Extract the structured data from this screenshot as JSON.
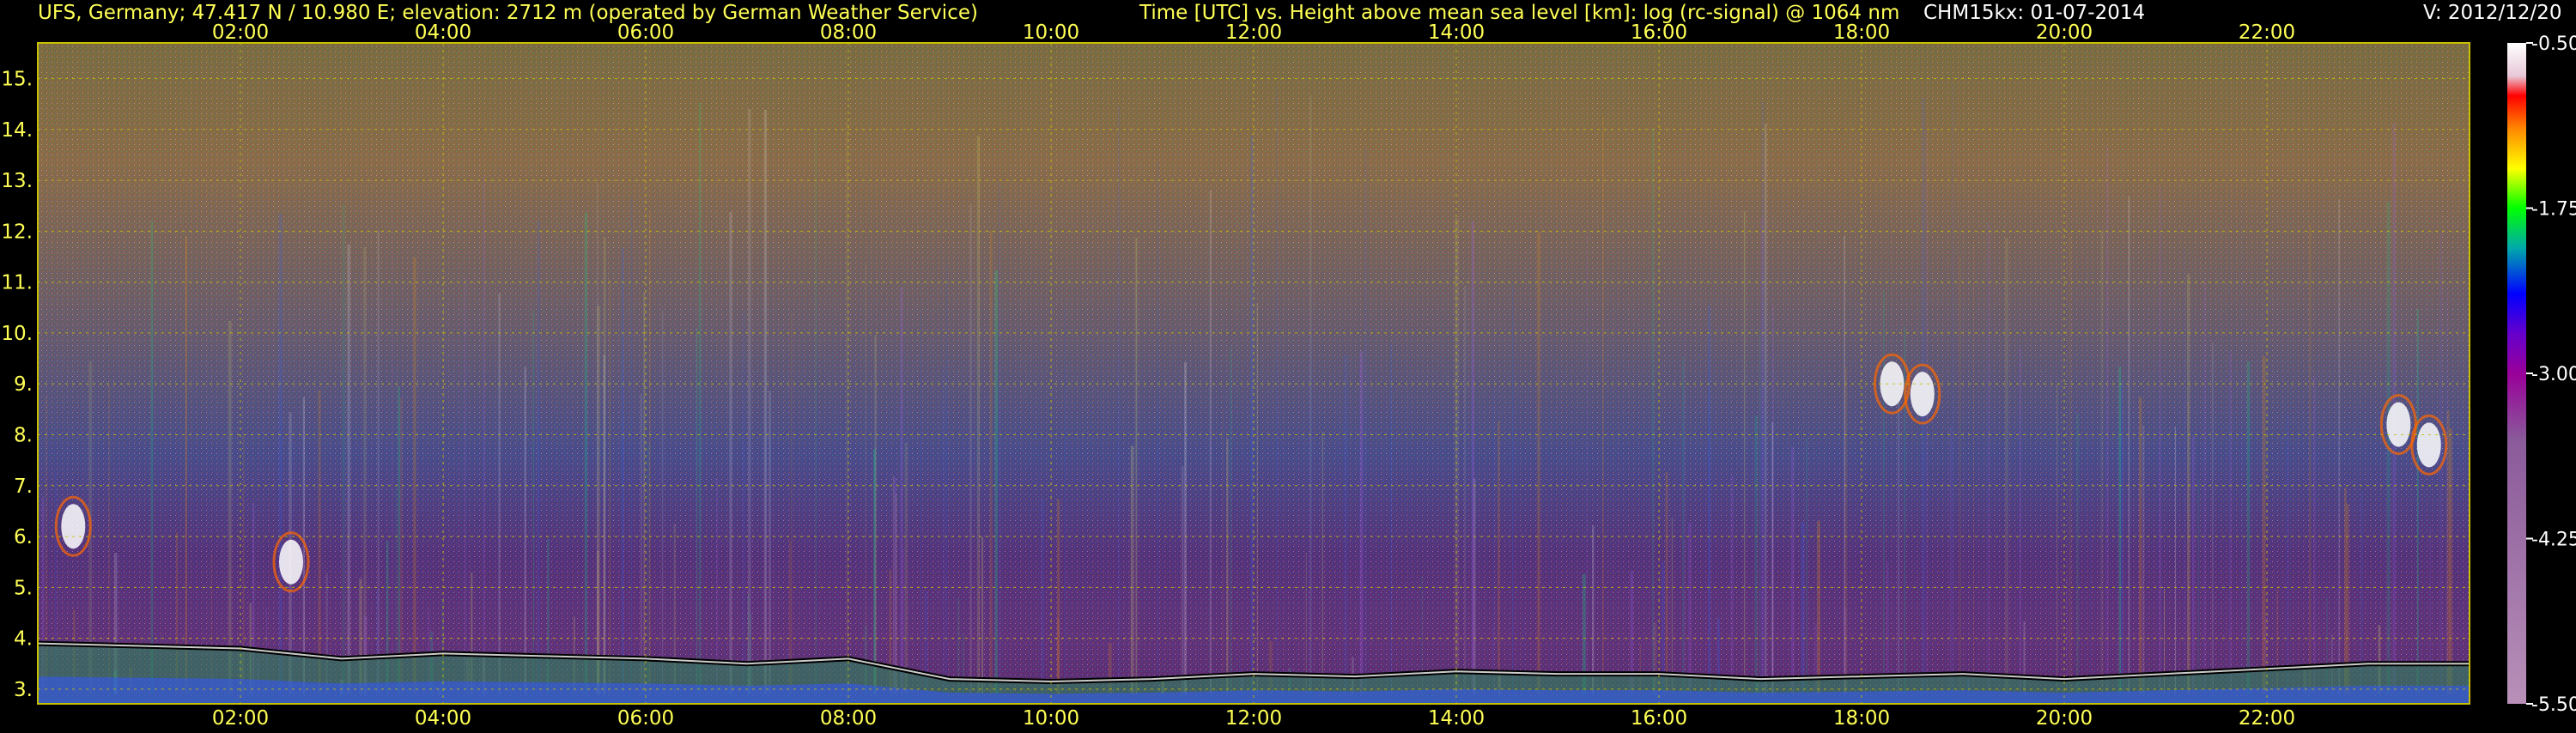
{
  "header": {
    "station": "UFS, Germany; 47.417 N / 10.980 E; elevation: 2712 m  (operated by German Weather Service)",
    "description": "Time [UTC] vs. Height above mean sea level [km]: log (rc-signal) @ 1064 nm",
    "instrument": "CHM15kx: 01-07-2014",
    "version": "V: 2012/12/20"
  },
  "colors": {
    "text": "#ffff55",
    "header_text": "#ffff55",
    "grid": "#c8c000",
    "axis_frame": "#c8c000",
    "colorbar_text": "#ffffff"
  },
  "chart_data": {
    "type": "heatmap",
    "title": "Time [UTC] vs. Height above mean sea level [km]: log (rc-signal) @ 1064 nm",
    "xlabel": "Time [UTC]",
    "ylabel": "Height above mean sea level [km]",
    "x_tick_labels": [
      "02:00",
      "04:00",
      "06:00",
      "08:00",
      "10:00",
      "12:00",
      "14:00",
      "16:00",
      "18:00",
      "20:00",
      "22:00"
    ],
    "x_ticks_hours": [
      2,
      4,
      6,
      8,
      10,
      12,
      14,
      16,
      18,
      20,
      22
    ],
    "xlim_hours": [
      0,
      24
    ],
    "y_tick_labels": [
      "3.",
      "4.",
      "5.",
      "6.",
      "7.",
      "8.",
      "9.",
      "10.",
      "11.",
      "12.",
      "13.",
      "14.",
      "15."
    ],
    "y_ticks_km": [
      3,
      4,
      5,
      6,
      7,
      8,
      9,
      10,
      11,
      12,
      13,
      14,
      15
    ],
    "ylim_km": [
      2.712,
      15.7
    ],
    "grid": true,
    "colorbar": {
      "tick_labels": [
        "-0.50",
        "-1.75",
        "-3.00",
        "-4.25",
        "-5.50"
      ],
      "ticks": [
        -0.5,
        -1.75,
        -3.0,
        -4.25,
        -5.5
      ],
      "range": [
        -5.5,
        -0.5
      ],
      "colors_high_to_low": [
        "#ffffff",
        "#e8c8d8",
        "#ff0000",
        "#ff8800",
        "#ffff00",
        "#00ff00",
        "#00aaaa",
        "#0000ff",
        "#6600cc",
        "#990099",
        "#8a5a9a",
        "#b890b8"
      ]
    },
    "features": {
      "boundary_layer_top_km": [
        [
          0.0,
          3.9
        ],
        [
          1.0,
          3.85
        ],
        [
          2.0,
          3.8
        ],
        [
          3.0,
          3.6
        ],
        [
          4.0,
          3.7
        ],
        [
          5.0,
          3.65
        ],
        [
          6.0,
          3.6
        ],
        [
          7.0,
          3.5
        ],
        [
          8.0,
          3.6
        ],
        [
          9.0,
          3.2
        ],
        [
          10.0,
          3.15
        ],
        [
          11.0,
          3.2
        ],
        [
          12.0,
          3.3
        ],
        [
          13.0,
          3.25
        ],
        [
          14.0,
          3.35
        ],
        [
          15.0,
          3.3
        ],
        [
          16.0,
          3.3
        ],
        [
          17.0,
          3.2
        ],
        [
          18.0,
          3.25
        ],
        [
          19.0,
          3.3
        ],
        [
          20.0,
          3.2
        ],
        [
          21.0,
          3.3
        ],
        [
          22.0,
          3.4
        ],
        [
          23.0,
          3.5
        ],
        [
          24.0,
          3.5
        ]
      ],
      "cloud_patches": [
        {
          "t": 0.35,
          "h": 6.2
        },
        {
          "t": 2.5,
          "h": 5.5
        },
        {
          "t": 18.3,
          "h": 9.0
        },
        {
          "t": 18.6,
          "h": 8.8
        },
        {
          "t": 23.3,
          "h": 8.2
        },
        {
          "t": 23.6,
          "h": 7.8
        }
      ]
    }
  }
}
